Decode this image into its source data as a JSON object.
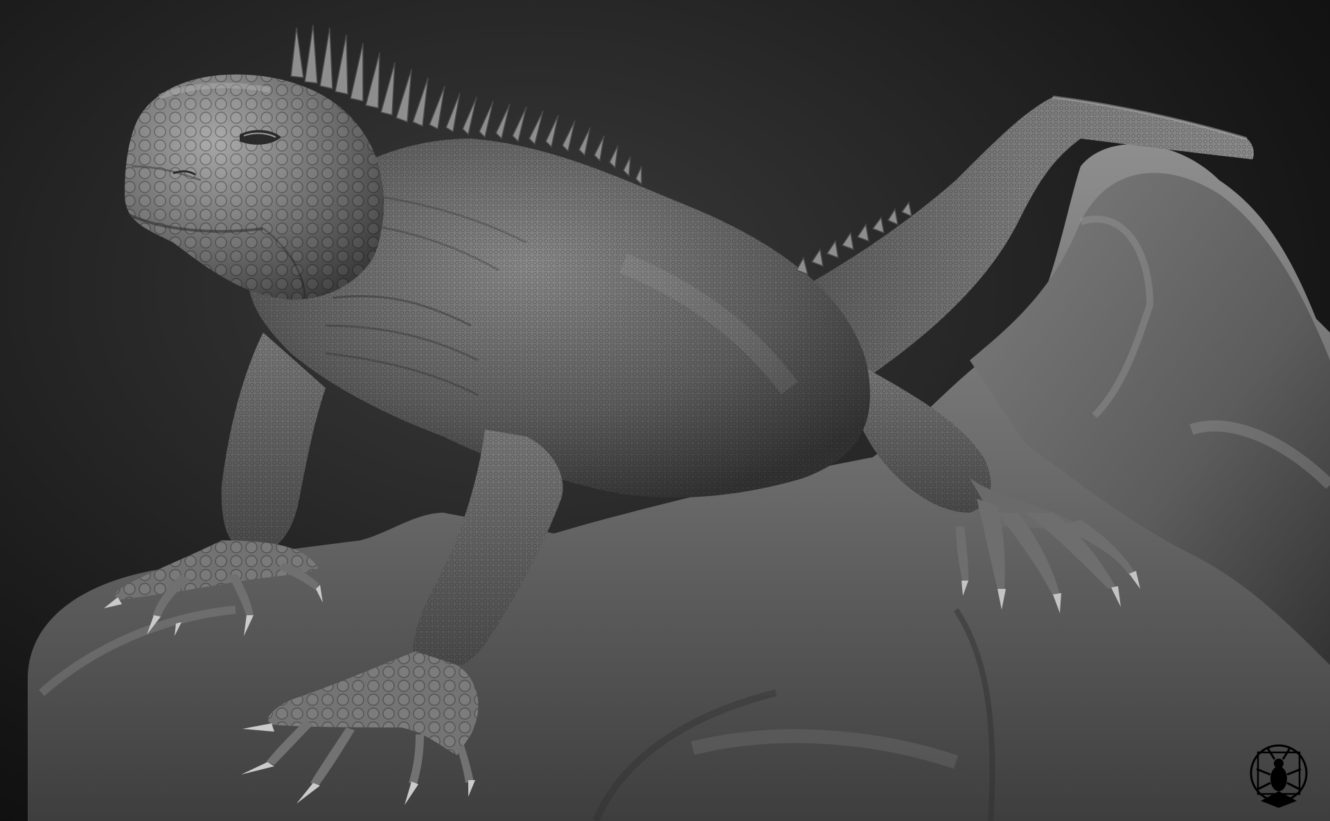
{
  "image": {
    "kind": "3d-sculpt-render",
    "subject": "iguana",
    "palette": {
      "background_center": "#3a3a3a",
      "background_edge": "#0b0b0b",
      "skin_light": "#9a9a9a",
      "skin_mid": "#6e6e6e",
      "skin_dark": "#3c3c3c",
      "rock_light": "#8c8c8c",
      "rock_dark": "#3a3a3a",
      "claw": "#c8c8c8"
    },
    "icons": {
      "watermark": "beetle-emblem-icon"
    }
  }
}
